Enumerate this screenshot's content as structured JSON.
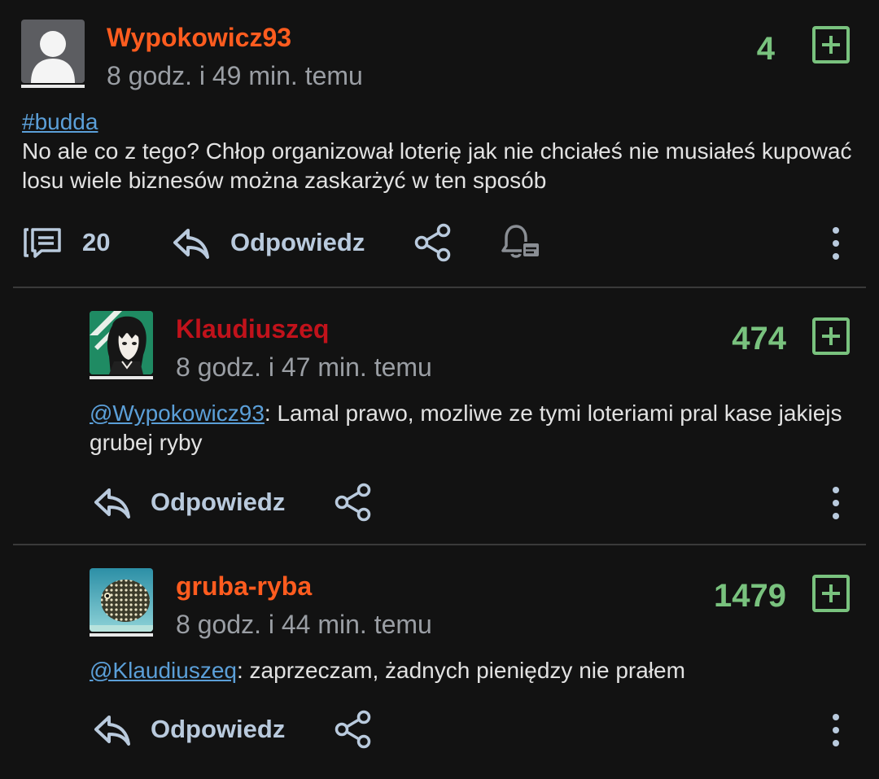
{
  "posts": [
    {
      "username": "Wypokowicz93",
      "username_color": "#ff5c1f",
      "time": "8 godz. i 49 min. temu",
      "score": "4",
      "tag": "#budda",
      "text": "No ale co z tego? Chłop organizował loterię jak nie chciałeś nie musiałeś kupować losu wiele biznesów można zaskarżyć w ten sposób",
      "comments_count": "20",
      "reply_label": "Odpowiedz"
    }
  ],
  "comments": [
    {
      "username": "Klaudiuszeq",
      "username_color": "#c1121b",
      "time": "8 godz. i 47 min. temu",
      "score": "474",
      "mention": "@Wypokowicz93",
      "text": ": Lamal prawo, mozliwe ze tymi loteriami pral kase jakiejs grubej ryby",
      "reply_label": "Odpowiedz"
    },
    {
      "username": "gruba-ryba",
      "username_color": "#ff5c1f",
      "time": "8 godz. i 44 min. temu",
      "score": "1479",
      "mention": "@Klaudiuszeq",
      "text": ": zaprzeczam, żadnych pieniędzy nie prałem",
      "reply_label": "Odpowiedz"
    }
  ],
  "colors": {
    "background": "#121212",
    "vote_green": "#79c27e",
    "action_blue": "#b9cadd",
    "link_blue": "#5b9fd8"
  }
}
